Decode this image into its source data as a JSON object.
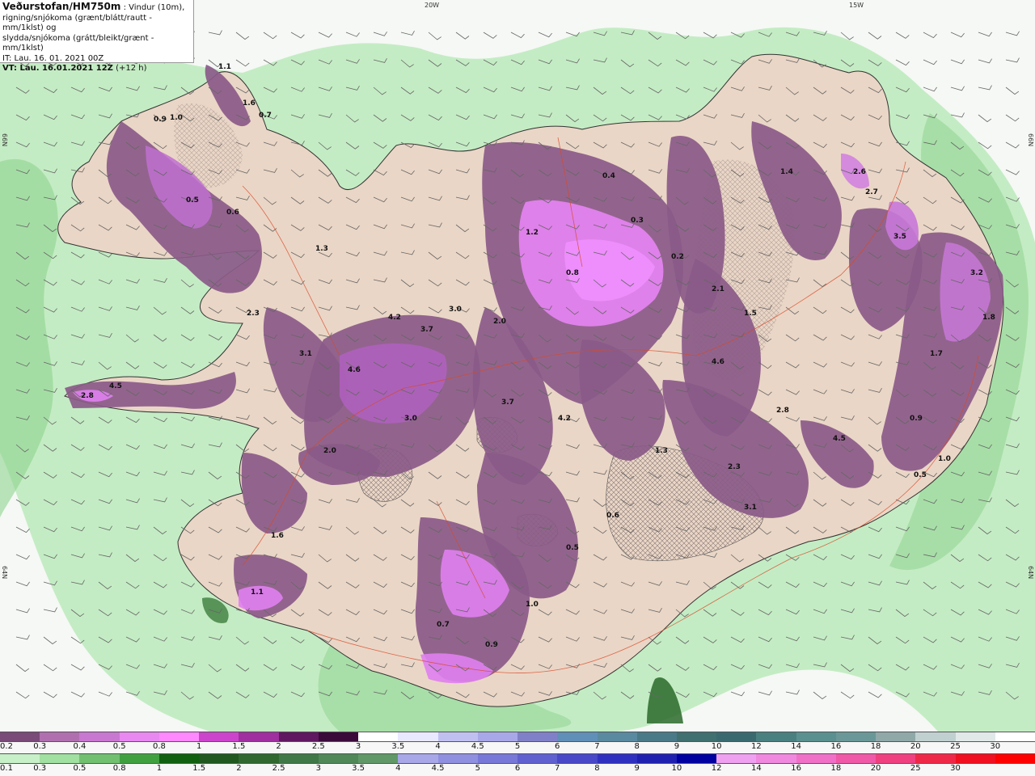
{
  "header": {
    "title": "Veðurstofan/HM750m",
    "subtitle_1": " : Vindur (10m),",
    "line_2": "rigning/snjókoma (grænt/blátt/rautt - mm/1klst) og",
    "line_3": "slydda/snjókoma (grátt/bleikt/grænt - mm/1klst)",
    "issue_time": "IT: Lau. 16. 01. 2021 00Z",
    "valid_time": "VT: Lau. 16.01.2021 12Z",
    "lead_time": "(+12 h)"
  },
  "coords": {
    "lon_20w": "20W",
    "lon_15w": "15W",
    "lat_left_66": "66N",
    "lat_right_66": "66N",
    "lat_left_64": "64N",
    "lat_right_64": "64N"
  },
  "legend_sleet": {
    "colors": [
      "#7a4a78",
      "#b070b0",
      "#c878d0",
      "#e888f0",
      "#ff88ff",
      "#cc44cc",
      "#a030a0",
      "#601860",
      "#3a0a3a",
      "#ffffff",
      "#e8e8ff",
      "#c0c0f0",
      "#a8a8e8",
      "#8080c8",
      "#6090b8",
      "#5a8aa0",
      "#4a7a88",
      "#407070",
      "#3a6a70",
      "#4a8080",
      "#5a9090",
      "#6a9898",
      "#90a8a8",
      "#c0d0d0",
      "#e0e8e8",
      "#ffffff"
    ],
    "labels": [
      "0.2",
      "0.3",
      "0.4",
      "0.5",
      "0.8",
      "1",
      "1.5",
      "2",
      "2.5",
      "3",
      "3.5",
      "4",
      "4.5",
      "5",
      "6",
      "7",
      "8",
      "9",
      "10",
      "12",
      "14",
      "16",
      "18",
      "20",
      "25",
      "30"
    ]
  },
  "legend_rain": {
    "colors": [
      "#c8f0c8",
      "#a0e0a0",
      "#70c070",
      "#40a040",
      "#106010",
      "#205820",
      "#306830",
      "#407848",
      "#508858",
      "#609868",
      "#a8a8e8",
      "#9090e0",
      "#7878d8",
      "#6060d0",
      "#4848c8",
      "#3030c0",
      "#2020b0",
      "#0000a0",
      "#f0a0f0",
      "#f088e0",
      "#f070c8",
      "#f058a8",
      "#f04080",
      "#f02848",
      "#f01020",
      "#ff0000"
    ],
    "labels": [
      "0.1",
      "0.3",
      "0.5",
      "0.8",
      "1",
      "1.5",
      "2",
      "2.5",
      "3",
      "3.5",
      "4",
      "4.5",
      "5",
      "6",
      "7",
      "8",
      "9",
      "10",
      "12",
      "14",
      "16",
      "18",
      "20",
      "25",
      "30"
    ]
  },
  "precip_values": [
    "1.1",
    "1.6",
    "0.7",
    "0.9",
    "1.0",
    "0.5",
    "0.6",
    "1.3",
    "2.3",
    "3.1",
    "2.8",
    "4.5",
    "4.6",
    "4.2",
    "3.7",
    "3.0",
    "2.0",
    "1.2",
    "0.8",
    "0.4",
    "0.3",
    "0.2",
    "2.1",
    "1.5",
    "1.4",
    "2.6",
    "2.7",
    "3.5",
    "3.2",
    "1.8",
    "1.7",
    "0.9",
    "1.0",
    "0.5"
  ],
  "colors": {
    "ocean": "#f4f7f4",
    "land": "#ecd8c8",
    "glacier": "#f5eef0",
    "sleet": "#a060b0",
    "sleet_light": "#e080f0",
    "rain_light": "#b8eab8",
    "rain_mid": "#78c878",
    "rain_dark": "#2a6a2a",
    "roads": "#d84828"
  }
}
